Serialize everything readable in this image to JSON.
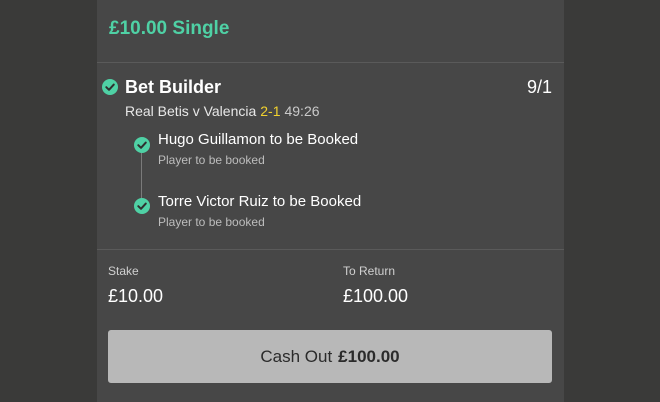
{
  "bet": {
    "title": "£10.00 Single",
    "builder_label": "Bet Builder",
    "odds": "9/1",
    "match": "Real Betis v Valencia",
    "score": "2-1",
    "time": "49:26",
    "legs": [
      {
        "name": "Hugo Guillamon to be Booked",
        "market": "Player to be booked"
      },
      {
        "name": "Torre Victor Ruiz to be Booked",
        "market": "Player to be booked"
      }
    ]
  },
  "summary": {
    "stake_label": "Stake",
    "stake_value": "£10.00",
    "return_label": "To Return",
    "return_value": "£100.00"
  },
  "cashout": {
    "label": "Cash Out",
    "amount": "£100.00"
  },
  "icons": {
    "leg_status": "check-circle-icon"
  },
  "colors": {
    "accent_green": "#4fd1a5",
    "score_yellow": "#f2d22e",
    "panel_bg": "#474747",
    "button_bg": "#b8b8b8"
  }
}
